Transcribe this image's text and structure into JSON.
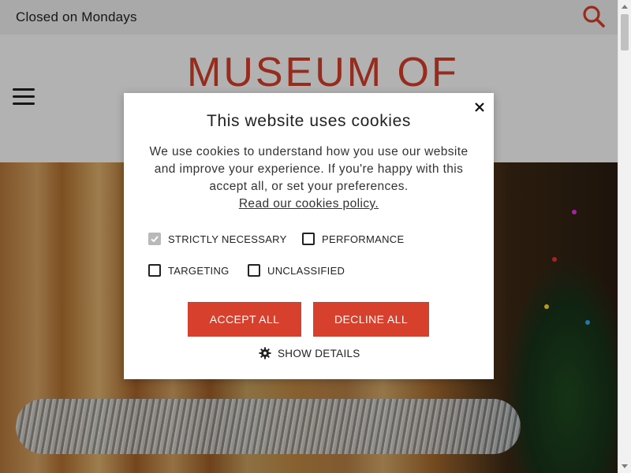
{
  "topbar": {
    "hours_text": "Closed on Mondays",
    "search_icon": "search-icon"
  },
  "header": {
    "menu_icon": "hamburger-menu-icon",
    "logo_text": "MUSEUM OF"
  },
  "colors": {
    "accent": "#d6402c",
    "overlay": "rgba(0,0,0,0.3)"
  },
  "cookie_dialog": {
    "title": "This website uses cookies",
    "description": "We use cookies to understand how you use our website and improve your experience. If you're happy with this accept all, or set your preferences.",
    "policy_link": "Read our cookies policy.",
    "options": [
      {
        "label": "STRICTLY NECESSARY",
        "checked": true,
        "disabled": true
      },
      {
        "label": "PERFORMANCE",
        "checked": false,
        "disabled": false
      },
      {
        "label": "TARGETING",
        "checked": false,
        "disabled": false
      },
      {
        "label": "UNCLASSIFIED",
        "checked": false,
        "disabled": false
      }
    ],
    "accept_label": "ACCEPT ALL",
    "decline_label": "DECLINE ALL",
    "details_label": "SHOW DETAILS",
    "close_icon": "close-icon",
    "details_icon": "gear-icon"
  }
}
